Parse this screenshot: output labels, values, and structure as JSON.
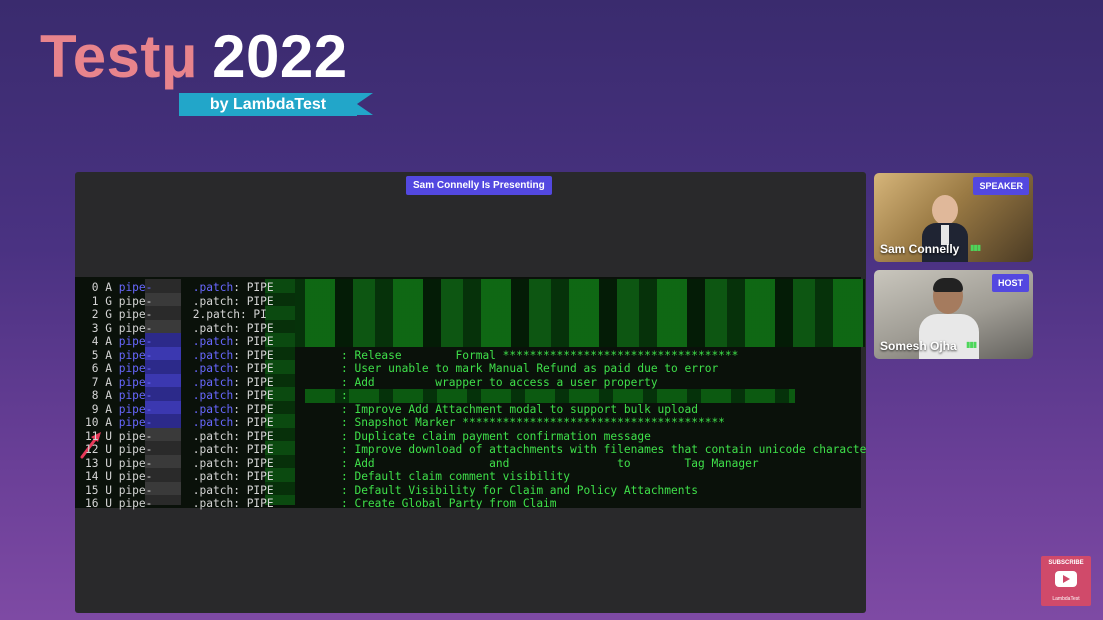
{
  "logo": {
    "brand": "Testμ",
    "year": "2022",
    "byline": "by LambdaTest"
  },
  "presentation": {
    "presenting_label": "Sam Connelly Is Presenting",
    "terminal_lines": [
      {
        "num": "0",
        "status": "A",
        "pipe_color": "#6868ff",
        "name": "pipe-",
        "suffix": ".patch",
        "tag": "PIPE",
        "description": ""
      },
      {
        "num": "1",
        "status": "G",
        "pipe_color": "#d5d5d5",
        "name": "pipe-",
        "suffix": ".patch",
        "tag": "PIPE",
        "description": ""
      },
      {
        "num": "2",
        "status": "G",
        "pipe_color": "#d5d5d5",
        "name": "pipe-",
        "suffix": "2.patch",
        "tag": "PI",
        "description": ""
      },
      {
        "num": "3",
        "status": "G",
        "pipe_color": "#d5d5d5",
        "name": "pipe-",
        "suffix": ".patch",
        "tag": "PIPE",
        "description": ""
      },
      {
        "num": "4",
        "status": "A",
        "pipe_color": "#6868ff",
        "name": "pipe-",
        "suffix": ".patch",
        "tag": "PIPE",
        "description": ""
      },
      {
        "num": "5",
        "status": "A",
        "pipe_color": "#6868ff",
        "name": "pipe-",
        "suffix": ".patch",
        "tag": "PIPE",
        "description": ": Release        Formal ***********************************"
      },
      {
        "num": "6",
        "status": "A",
        "pipe_color": "#6868ff",
        "name": "pipe-",
        "suffix": ".patch",
        "tag": "PIPE",
        "description": ": User unable to mark Manual Refund as paid due to error"
      },
      {
        "num": "7",
        "status": "A",
        "pipe_color": "#6868ff",
        "name": "pipe-",
        "suffix": ".patch",
        "tag": "PIPE",
        "description": ": Add         wrapper to access a user property"
      },
      {
        "num": "8",
        "status": "A",
        "pipe_color": "#6868ff",
        "name": "pipe-",
        "suffix": ".patch",
        "tag": "PIPE",
        "description": ":"
      },
      {
        "num": "9",
        "status": "A",
        "pipe_color": "#6868ff",
        "name": "pipe-",
        "suffix": ".patch",
        "tag": "PIPE",
        "description": ": Improve Add Attachment modal to support bulk upload"
      },
      {
        "num": "10",
        "status": "A",
        "pipe_color": "#6868ff",
        "name": "pipe-",
        "suffix": ".patch",
        "tag": "PIPE",
        "description": ": Snapshot Marker ***************************************"
      },
      {
        "num": "11",
        "status": "U",
        "pipe_color": "#d5d5d5",
        "name": "pipe-",
        "suffix": ".patch",
        "tag": "PIPE",
        "description": ": Duplicate claim payment confirmation message"
      },
      {
        "num": "12",
        "status": "U",
        "pipe_color": "#d5d5d5",
        "name": "pipe-",
        "suffix": ".patch",
        "tag": "PIPE",
        "description": ": Improve download of attachments with filenames that contain unicode characters"
      },
      {
        "num": "13",
        "status": "U",
        "pipe_color": "#d5d5d5",
        "name": "pipe-",
        "suffix": ".patch",
        "tag": "PIPE",
        "description": ": Add                 and                to        Tag Manager"
      },
      {
        "num": "14",
        "status": "U",
        "pipe_color": "#d5d5d5",
        "name": "pipe-",
        "suffix": ".patch",
        "tag": "PIPE",
        "description": ": Default claim comment visibility"
      },
      {
        "num": "15",
        "status": "U",
        "pipe_color": "#d5d5d5",
        "name": "pipe-",
        "suffix": ".patch",
        "tag": "PIPE",
        "description": ": Default Visibility for Claim and Policy Attachments"
      },
      {
        "num": "16",
        "status": "U",
        "pipe_color": "#d5d5d5",
        "name": "pipe-",
        "suffix": ".patch",
        "tag": "PIPE",
        "description": ": Create Global Party from Claim"
      }
    ]
  },
  "participants": [
    {
      "name": "Sam Connelly",
      "badge": "SPEAKER"
    },
    {
      "name": "Somesh Ojha",
      "badge": "HOST"
    }
  ],
  "subscribe": {
    "label": "SUBSCRIBE",
    "channel": "LambdaTest"
  },
  "colors": {
    "accent": "#5348e0",
    "terminal_green": "#3fe04a",
    "terminal_blue": "#6868ff",
    "brand_pink": "#e8848c",
    "ribbon": "#22a6c9"
  }
}
